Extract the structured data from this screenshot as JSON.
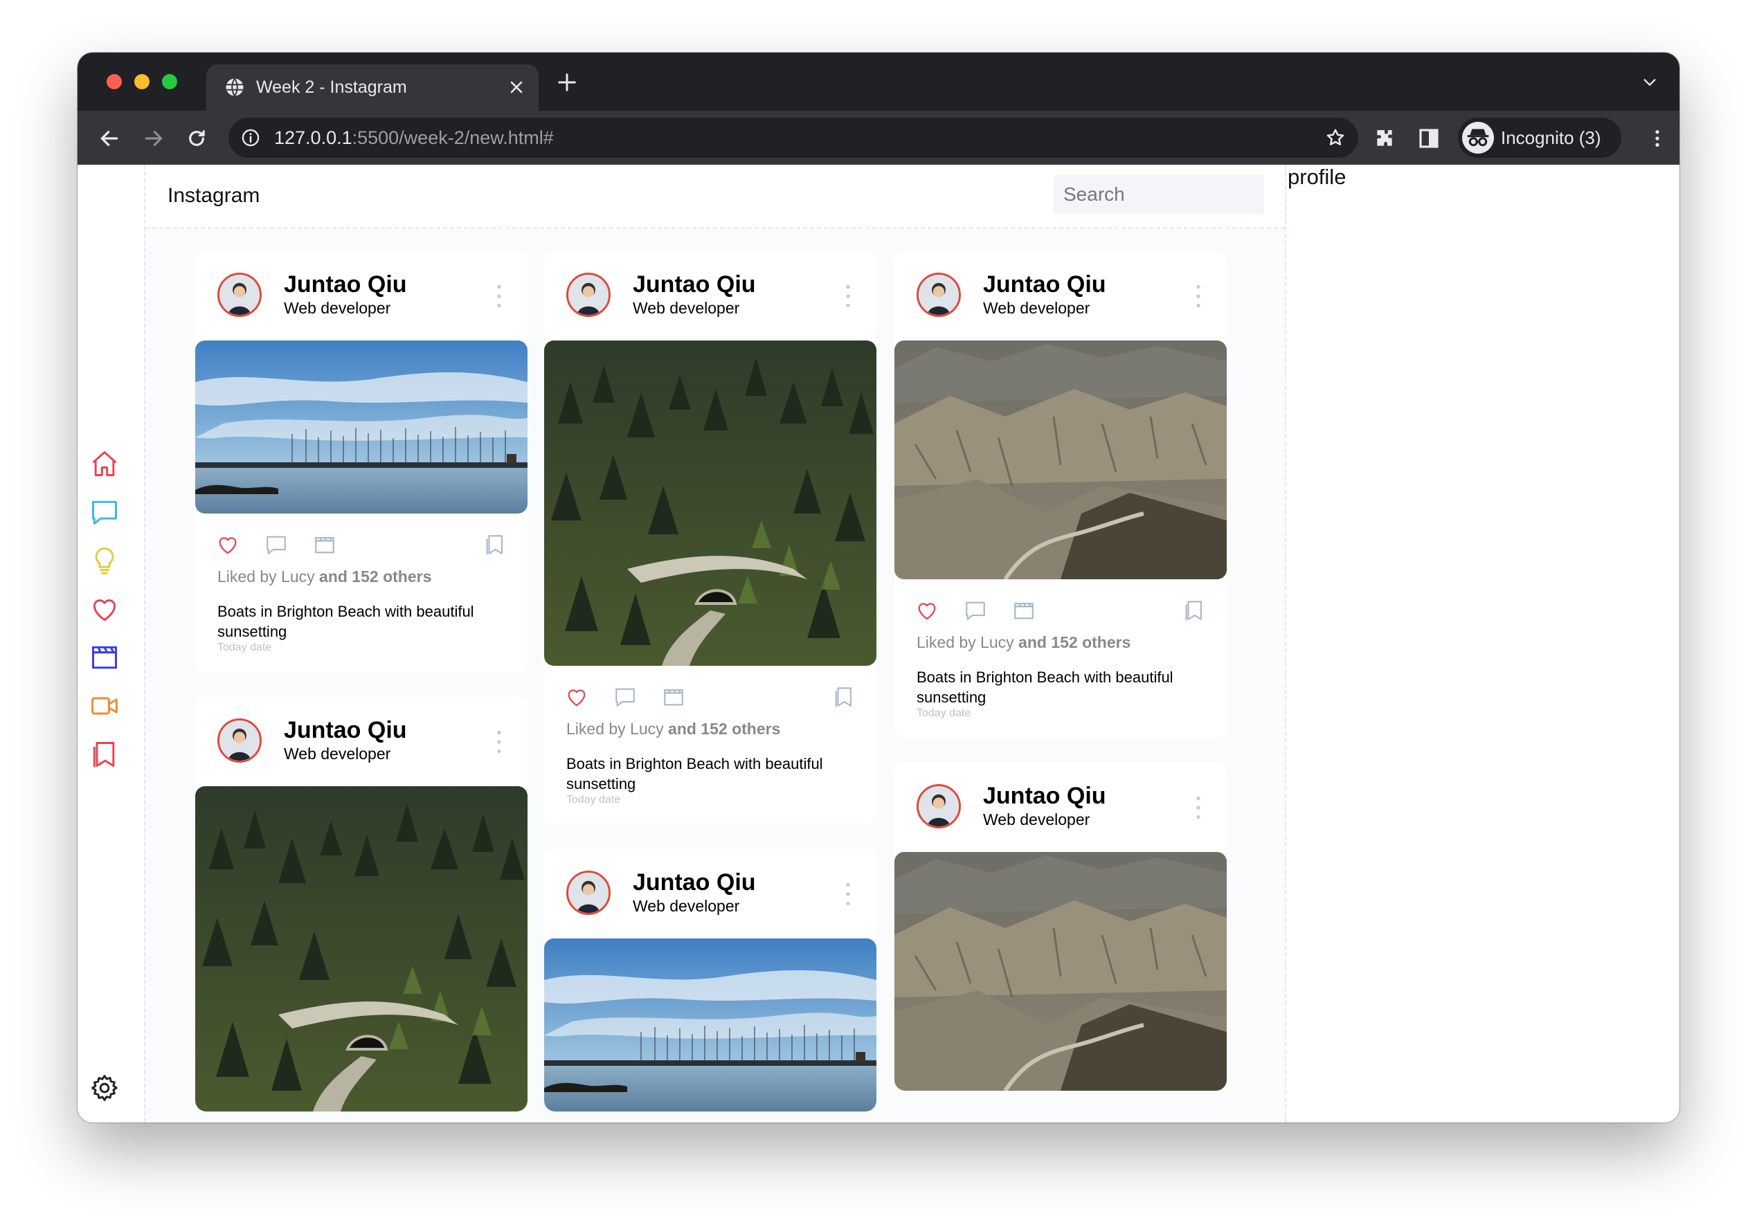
{
  "browser": {
    "tab_title": "Week 2 - Instagram",
    "url_host": "127.0.0.1",
    "url_rest": ":5500/week-2/new.html#",
    "incognito_label": "Incognito (3)"
  },
  "app": {
    "brand": "Instagram",
    "search_placeholder": "Search",
    "profile_label": "profile"
  },
  "nav_icons": [
    {
      "name": "home-icon",
      "color": "#e8434f"
    },
    {
      "name": "messages-icon",
      "color": "#3bb6e8"
    },
    {
      "name": "lightbulb-icon",
      "color": "#e8c93b"
    },
    {
      "name": "heart-icon",
      "color": "#e8434f"
    },
    {
      "name": "clapperboard-icon",
      "color": "#3b3be8"
    },
    {
      "name": "video-camera-icon",
      "color": "#f08a2e"
    },
    {
      "name": "bookmarks-icon",
      "color": "#e8434f"
    },
    {
      "name": "settings-icon",
      "color": "#222222"
    }
  ],
  "post": {
    "author": "Juntao Qiu",
    "role": "Web developer",
    "liked_by": "Liked by Lucy",
    "liked_others": "and 152 others",
    "caption": "Boats in Brighton Beach with beautiful sunsetting",
    "date": "Today date"
  },
  "columns": [
    [
      {
        "photo": "harbor",
        "show_footer": true
      },
      {
        "photo": "forest",
        "show_footer": false
      }
    ],
    [
      {
        "photo": "forest",
        "show_footer": true
      },
      {
        "photo": "harbor",
        "show_footer": false
      }
    ],
    [
      {
        "photo": "mountains",
        "show_footer": true
      },
      {
        "photo": "mountains",
        "show_footer": false
      }
    ]
  ]
}
